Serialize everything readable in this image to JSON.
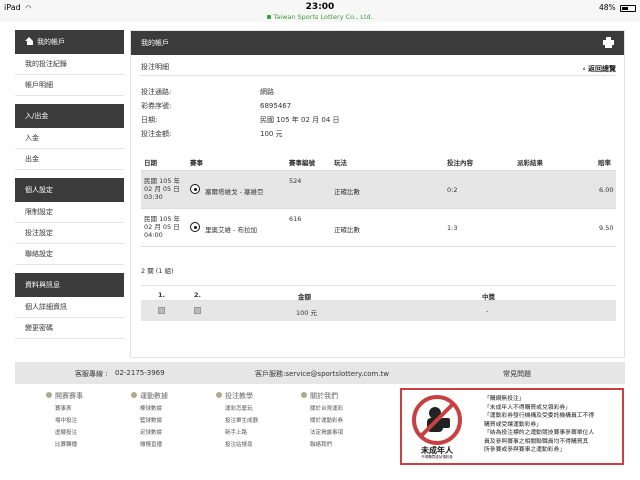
{
  "statusbar": {
    "device": "iPad",
    "time": "23:00",
    "url": "Taiwan Sports Lottery Co., Ltd.",
    "battery": "48%",
    "battery_level": 0.48
  },
  "sidebar": {
    "header": "我的帳戶",
    "groups": [
      {
        "title": null,
        "items": [
          "我的投注紀錄",
          "帳戶明細"
        ]
      },
      {
        "title": "入/出金",
        "items": [
          "入金",
          "出金"
        ]
      },
      {
        "title": "個人設定",
        "items": [
          "限制設定",
          "投注設定",
          "聯絡設定"
        ]
      },
      {
        "title": "資料與訊息",
        "items": [
          "個人詳細資訊",
          "變更密碼"
        ]
      }
    ]
  },
  "main": {
    "header": "我的帳戶",
    "subtitle": "投注明細",
    "back_link": "‹ 返回總覽",
    "info": [
      {
        "label": "投注通路:",
        "value": "網路"
      },
      {
        "label": "彩券序號:",
        "value": "6895467"
      },
      {
        "label": "日期:",
        "value": "民國 105 年 02 月 04 日"
      },
      {
        "label": "投注金額:",
        "value": "100 元"
      }
    ],
    "columns": [
      "日期",
      "賽事",
      "賽事編號",
      "玩法",
      "投注內容",
      "派彩結果",
      "賠率"
    ],
    "bets": [
      {
        "date_l1": "民國 105 年",
        "date_l2": "02 月 05 日",
        "date_l3": "03:30",
        "match": "塞爾塔維戈 - 塞維亞",
        "match_no": "524",
        "play": "正確比數",
        "content": "0:2",
        "result": "",
        "odds": "6.00"
      },
      {
        "date_l1": "民國 105 年",
        "date_l2": "02 月 05 日",
        "date_l3": "04:00",
        "match": "里奧艾維 - 布拉加",
        "match_no": "616",
        "play": "正確比數",
        "content": "1:3",
        "result": "",
        "odds": "9.50"
      }
    ],
    "combo": "2 關 (1 組)",
    "combo_table": {
      "columns": [
        "1.",
        "2.",
        "金額",
        "中獎"
      ],
      "row": {
        "amount": "100 元",
        "win": "-"
      }
    }
  },
  "footer": {
    "hotline_label": "客服專線 :",
    "hotline": "02-2175-3969",
    "email": "客戶服務:service@sportslottery.com.tw",
    "faq": "常見問題",
    "columns": [
      {
        "title": "開賽賽事",
        "links": [
          "賽事表",
          "場中投注",
          "虛擬投注",
          "比賽轉播"
        ]
      },
      {
        "title": "運動數據",
        "links": [
          "棒球數據",
          "籃球數據",
          "足球數據",
          "橄欖直播"
        ]
      },
      {
        "title": "投注教學",
        "links": [
          "運彩怎麼玩",
          "投注單生成器",
          "新手上路",
          "投注站搜尋"
        ]
      },
      {
        "title": "關於我們",
        "links": [
          "關於台灣運彩",
          "關於運動彩券",
          "法定揭露事項",
          "聯絡我們"
        ]
      }
    ],
    "warning_lines": [
      "「購網無投注」",
      "「未成年人不得購買或兌領彩券」",
      "「運動彩券發行機構及受委託機構員工不得",
      "購買或受讓運動彩券」",
      "「納為投注標的之運動競技賽事參賽單位人",
      "員及參與賽事之相關聯職員均不得購買其",
      "所參賽或參與賽事之運動彩券」"
    ],
    "warning_badge": "未成年人",
    "warning_badge_sub": "不得購買或兌領彩券"
  },
  "colors": {
    "dark_header": "#3b3b3b",
    "row_alt": "#e6e6e6",
    "url_green": "#3a9e3a",
    "warn_red": "#c94040"
  }
}
